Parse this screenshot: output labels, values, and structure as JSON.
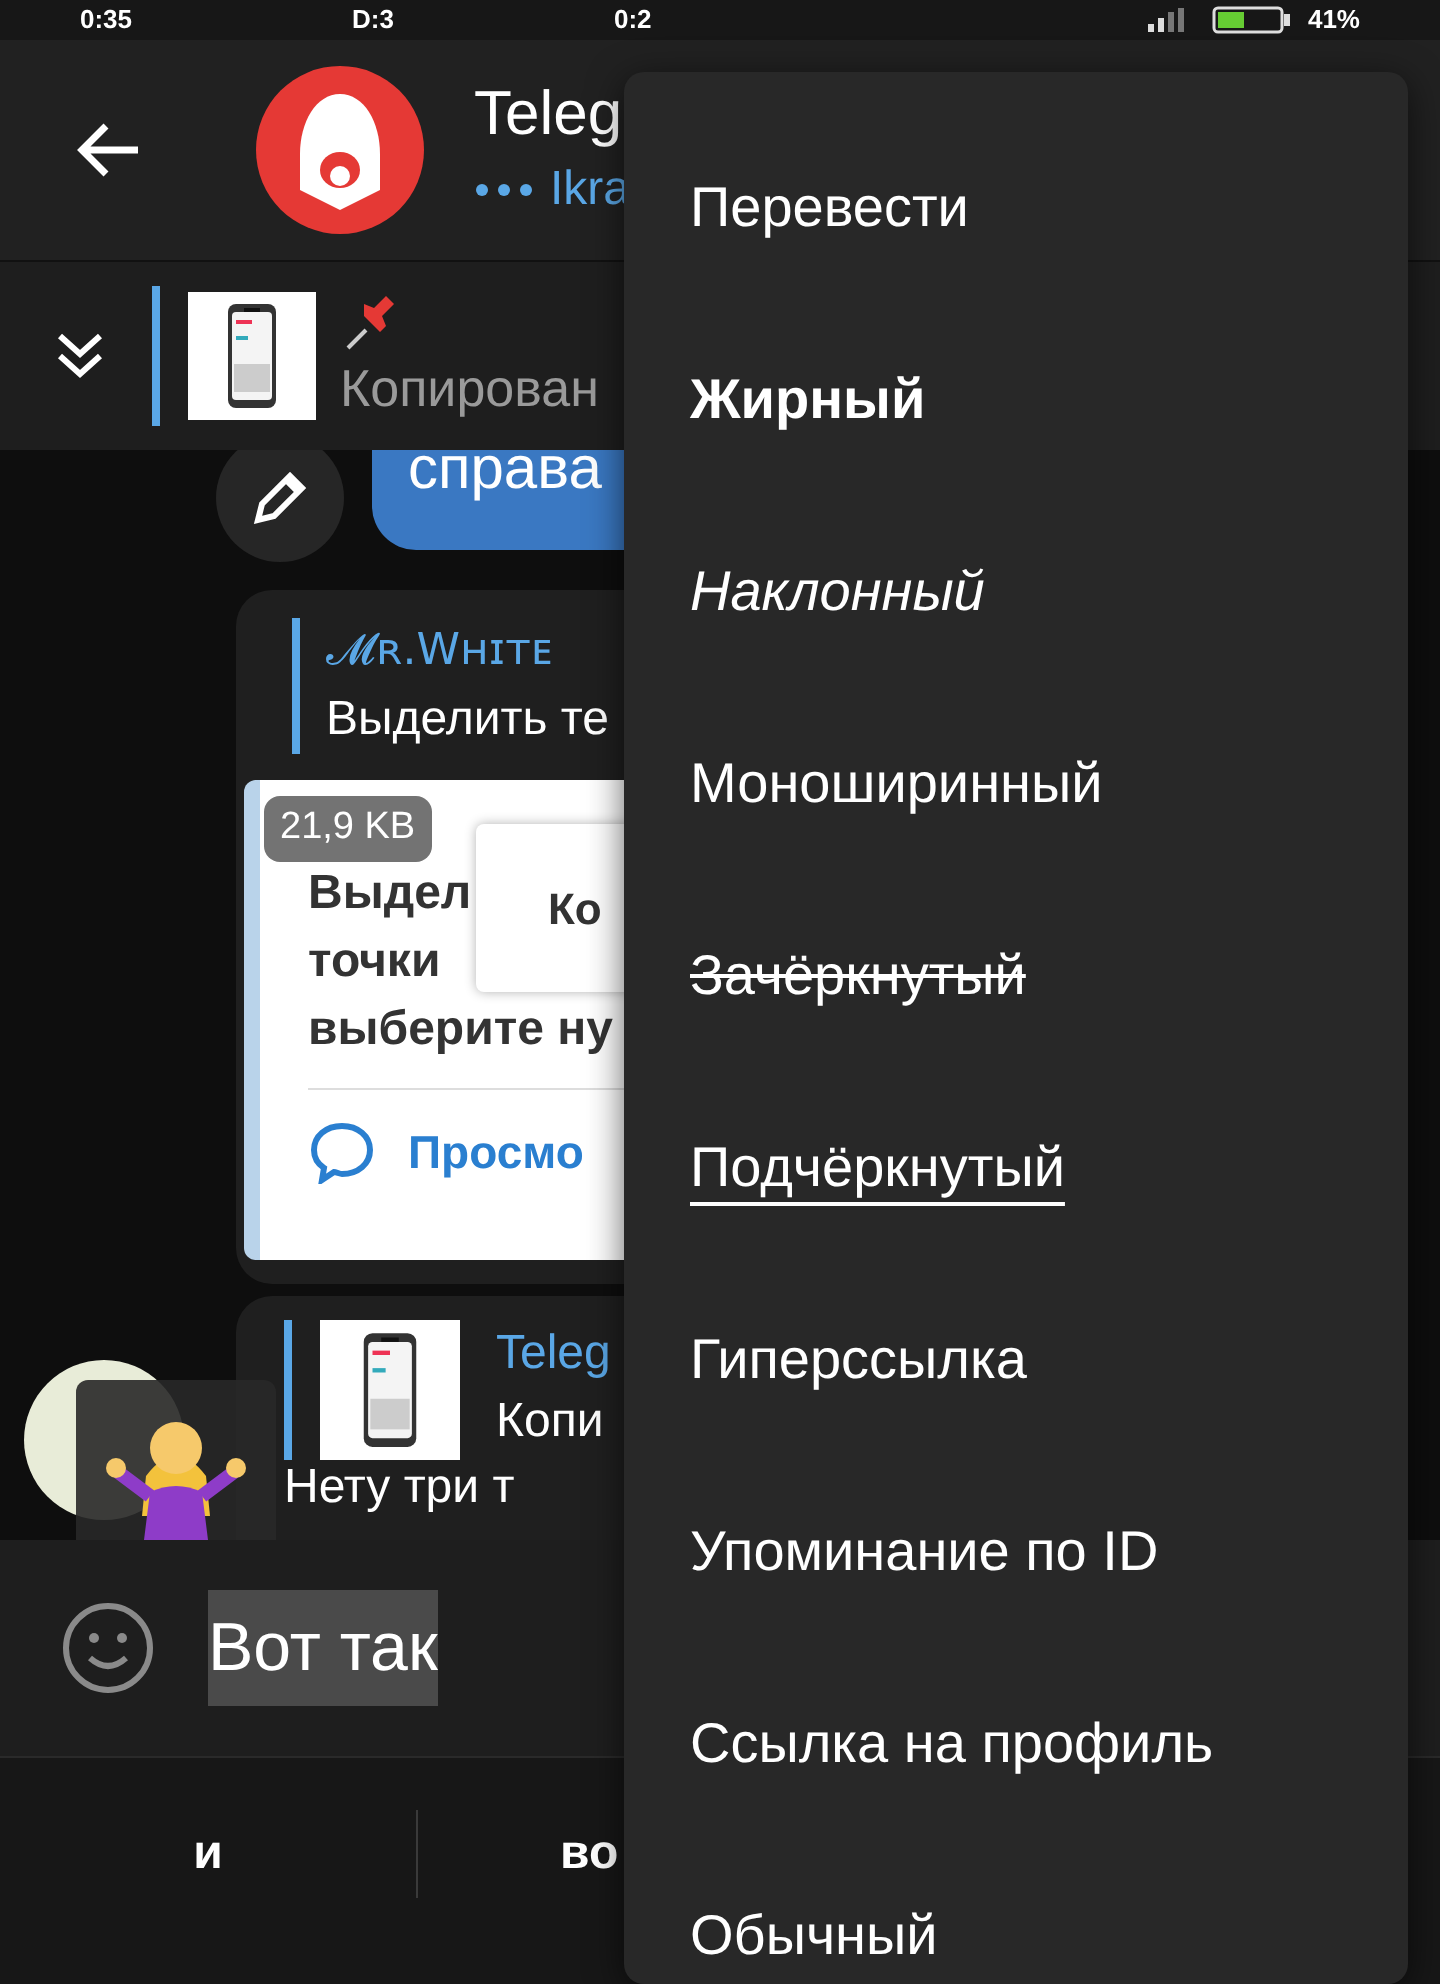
{
  "status_bar": {
    "time": "0:35",
    "items": [
      "D:3",
      "0:2"
    ],
    "battery": "41%"
  },
  "header": {
    "title": "Teleg",
    "subtitle": "Ikra"
  },
  "pinned": {
    "text": "Копирован"
  },
  "messages": [
    {
      "kind": "outgoing",
      "text": "справа"
    },
    {
      "kind": "reply_image",
      "reply_author": "𝓜ʀ.Wʜɪᴛᴇ",
      "reply_text": "Выделить те",
      "size": "21,9 KB",
      "screenshot_lines": [
        "Выдел",
        "точки",
        "выберите ну"
      ],
      "screenshot_popup": "Ко",
      "screenshot_link": "Просмо"
    },
    {
      "kind": "reply_text",
      "reply_author": "Teleg",
      "reply_text": "Копи",
      "text": "Нету три т"
    }
  ],
  "input": {
    "value": "Вот так",
    "selected": true
  },
  "suggestions": [
    "и",
    "во"
  ],
  "menu": [
    {
      "label": "Перевести",
      "kind": "plain"
    },
    {
      "label": "Жирный",
      "kind": "bold"
    },
    {
      "label": "Наклонный",
      "kind": "italic"
    },
    {
      "label": "Моноширинный",
      "kind": "plain"
    },
    {
      "label": "Зачёркнутый",
      "kind": "strike"
    },
    {
      "label": "Подчёркнутый",
      "kind": "underline"
    },
    {
      "label": "Гиперссылка",
      "kind": "plain"
    },
    {
      "label": "Упоминание по ID",
      "kind": "plain"
    },
    {
      "label": "Ссылка на профиль",
      "kind": "plain"
    },
    {
      "label": "Обычный",
      "kind": "plain"
    }
  ]
}
